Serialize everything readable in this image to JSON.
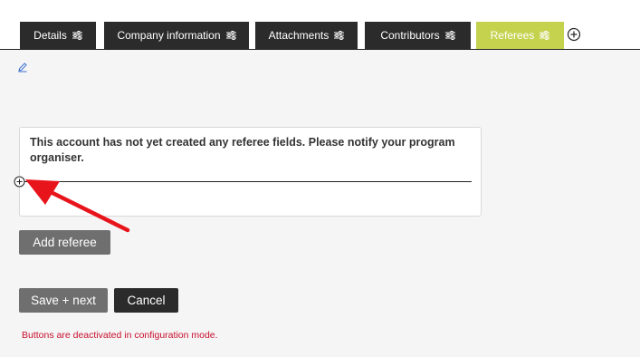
{
  "tabs": [
    {
      "label": "Details",
      "icon": "sliders-icon",
      "active": false
    },
    {
      "label": "Company information",
      "icon": "sliders-icon",
      "active": false
    },
    {
      "label": "Attachments",
      "icon": "sliders-icon",
      "active": false
    },
    {
      "label": "Contributors",
      "icon": "sliders-icon",
      "active": false
    },
    {
      "label": "Referees",
      "icon": "sliders-icon",
      "active": true
    }
  ],
  "add_tab_icon": "plus-circle-icon",
  "edit_icon": "pencil-icon",
  "notice": {
    "text": "This account has not yet created any referee fields. Please notify your program organiser."
  },
  "insert_icon": "plus-circle-icon",
  "annotation_icon": "red-arrow-icon",
  "buttons": {
    "add_referee": "Add referee",
    "save_next": "Save + next",
    "cancel": "Cancel"
  },
  "warning_text": "Buttons are deactivated in configuration mode.",
  "colors": {
    "tab_bg": "#2b2b2b",
    "tab_active_bg": "#c5d24e",
    "button_gray": "#6f6f6f",
    "button_dark": "#2b2b2b",
    "warning_red": "#c8102e",
    "annotation_red": "#e8141b"
  }
}
